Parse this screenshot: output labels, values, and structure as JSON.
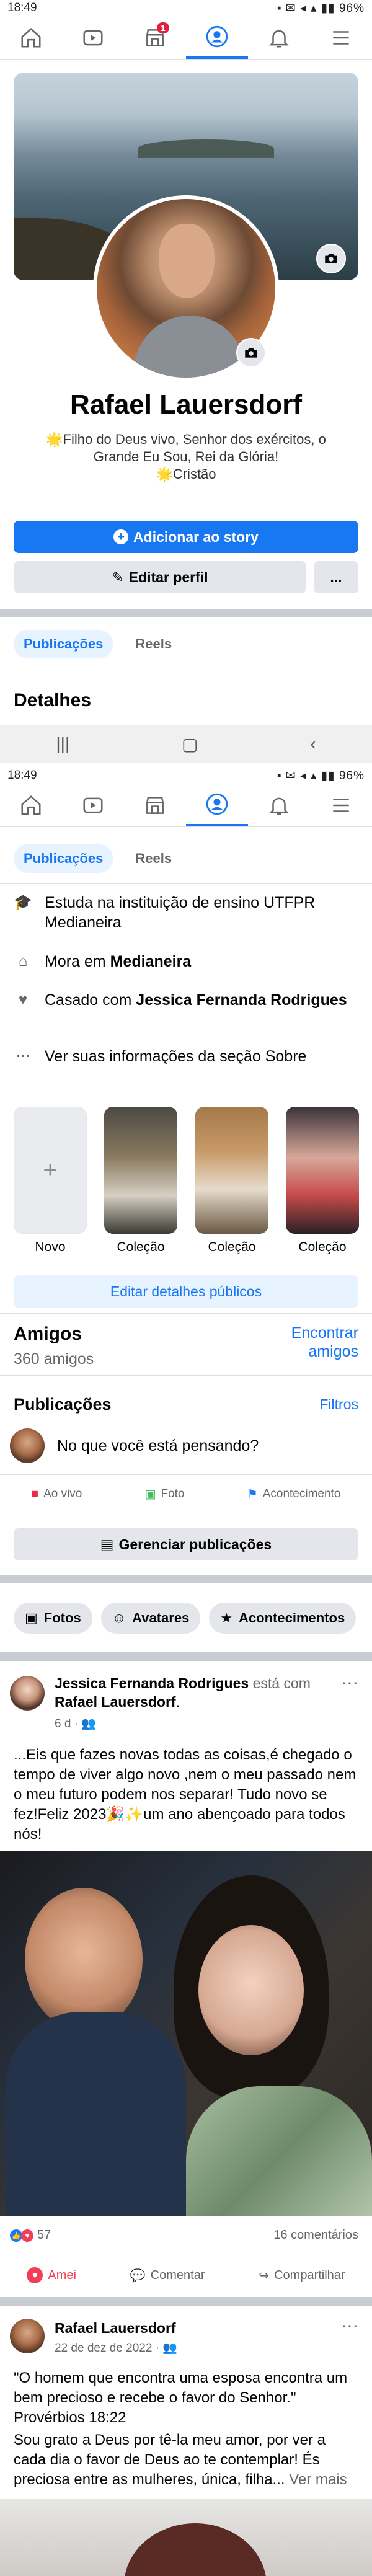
{
  "status_top": {
    "time": "18:49",
    "battery": "96%"
  },
  "status_mid": {
    "time": "18:49",
    "battery": "96%"
  },
  "nav": {
    "badge": "1"
  },
  "profile": {
    "name": "Rafael Lauersdorf",
    "bio_line1": "🌟Filho do Deus vivo, Senhor dos exércitos, o Grande Eu Sou, Rei da Glória!",
    "bio_line2": "🌟Cristão"
  },
  "buttons": {
    "add_story": "Adicionar ao story",
    "edit_profile": "Editar perfil",
    "more": "..."
  },
  "tabs": {
    "posts": "Publicações",
    "reels": "Reels"
  },
  "details": {
    "title": "Detalhes",
    "study": "Estuda na instituição de ensino UTFPR Medianeira",
    "lives_prefix": "Mora em ",
    "lives_city": "Medianeira",
    "married_prefix": "Casado com ",
    "married_name": "Jessica Fernanda Rodrigues",
    "about": "Ver suas informações da seção Sobre"
  },
  "featured": {
    "new": "Novo",
    "collection": "Coleção",
    "edit_public": "Editar detalhes públicos"
  },
  "friends": {
    "title": "Amigos",
    "count": "360 amigos",
    "find": "Encontrar amigos"
  },
  "posts_section": {
    "title": "Publicações",
    "filters": "Filtros",
    "composer_placeholder": "No que você está pensando?",
    "live": "Ao vivo",
    "photo": "Foto",
    "event": "Acontecimento",
    "manage": "Gerenciar publicações"
  },
  "chips": {
    "photos": "Fotos",
    "avatars": "Avatares",
    "events": "Acontecimentos"
  },
  "post1": {
    "author": "Jessica Fernanda Rodrigues",
    "with_text": "está com",
    "with_name": "Rafael Lauersdorf",
    "time": "6 d",
    "text": "...Eis que fazes novas todas as coisas,é chegado o tempo de viver algo novo ,nem o meu passado nem o meu futuro podem nos separar! Tudo novo se fez!Feliz 2023🎉✨um ano abençoado para todos nós!",
    "reactions": "57",
    "comments": "16 comentários",
    "like": "Amei",
    "comment": "Comentar",
    "share": "Compartilhar"
  },
  "post2": {
    "author": "Rafael Lauersdorf",
    "time": "22 de dez de 2022",
    "text": "\"O homem que encontra uma esposa encontra um bem precioso e recebe o favor do Senhor.\" Provérbios 18:22",
    "text2": "Sou grato a Deus por tê-la meu amor, por ver a cada dia o favor de Deus ao te contemplar! És preciosa entre as mulheres, única, filha...",
    "more": "Ver mais"
  },
  "colors": {
    "accent": "#1877f2",
    "separator": "#c9ccd1",
    "love": "#f33e58"
  }
}
